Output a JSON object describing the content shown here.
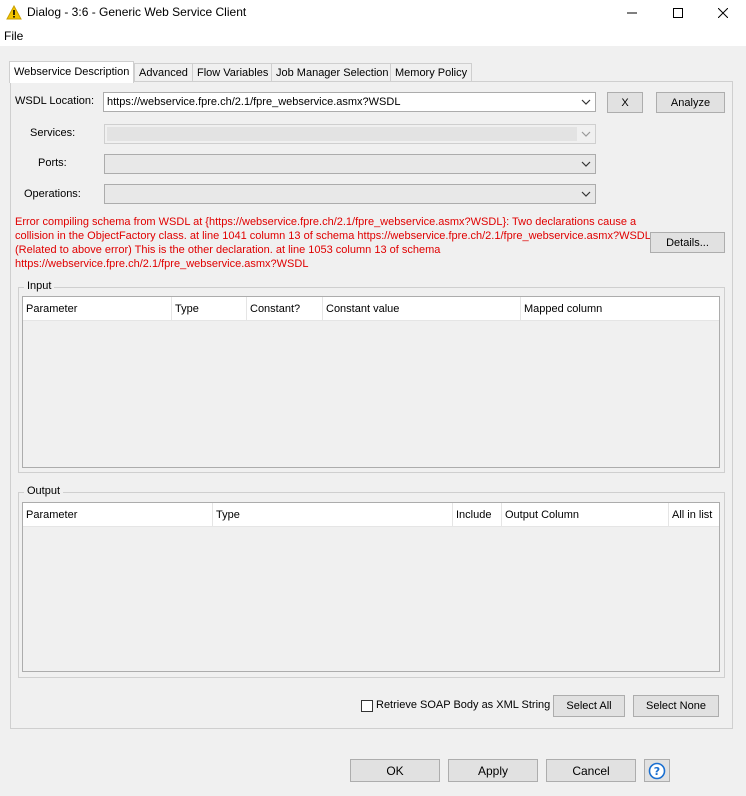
{
  "window": {
    "title": "Dialog - 3:6 - Generic Web Service Client"
  },
  "menu": {
    "file": "File"
  },
  "tabs": [
    "Webservice Description",
    "Advanced",
    "Flow Variables",
    "Job Manager Selection",
    "Memory Policy"
  ],
  "form": {
    "wsdl_label": "WSDL Location:",
    "wsdl_value": "https://webservice.fpre.ch/2.1/fpre_webservice.asmx?WSDL",
    "clear_button": "X",
    "analyze_button": "Analyze",
    "services_label": "Services:",
    "ports_label": "Ports:",
    "operations_label": "Operations:"
  },
  "error": {
    "lines": [
      "Error compiling schema from WSDL at {https://webservice.fpre.ch/2.1/fpre_webservice.asmx?WSDL}: Two declarations cause a",
      "collision in the ObjectFactory class. at line 1041 column 13 of schema https://webservice.fpre.ch/2.1/fpre_webservice.asmx?WSDL",
      "(Related to above error) This is the other declaration. at line 1053 column 13 of schema",
      "https://webservice.fpre.ch/2.1/fpre_webservice.asmx?WSDL"
    ],
    "details_button": "Details..."
  },
  "input_group": {
    "title": "Input",
    "columns": [
      "Parameter",
      "Type",
      "Constant?",
      "Constant value",
      "Mapped column"
    ]
  },
  "output_group": {
    "title": "Output",
    "columns": [
      "Parameter",
      "Type",
      "Include",
      "Output Column",
      "All in list"
    ]
  },
  "bottom": {
    "retrieve_soap_label": "Retrieve SOAP Body as XML String",
    "retrieve_soap_checked": false,
    "select_all": "Select All",
    "select_none": "Select None"
  },
  "footer": {
    "ok": "OK",
    "apply": "Apply",
    "cancel": "Cancel"
  },
  "colors": {
    "error": "#e00000",
    "help_accent": "#1a6fd1",
    "warning_icon": "#f2c400"
  }
}
